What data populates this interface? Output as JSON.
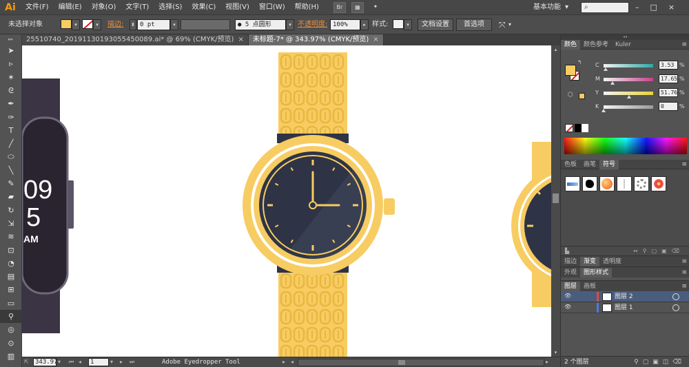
{
  "app": {
    "logo": "Ai"
  },
  "menu": [
    "文件(F)",
    "编辑(E)",
    "对象(O)",
    "文字(T)",
    "选择(S)",
    "效果(C)",
    "视图(V)",
    "窗口(W)",
    "帮助(H)"
  ],
  "workspace": {
    "label": "基本功能",
    "arrow": "▾"
  },
  "window_controls": [
    "–",
    "□",
    "×"
  ],
  "control_bar": {
    "selection_status": "未选择对象",
    "fill_color": "#f7cc62",
    "stroke_label": "描边:",
    "stroke_value": "0 pt",
    "brush_label": "5 点圆形",
    "opacity_label": "不透明度:",
    "opacity_value": "100%",
    "style_label": "样式:",
    "doc_setup_button": "文档设置",
    "preferences_button": "首选项"
  },
  "tabs": [
    {
      "label": "25510740_20191130193055450089.ai* @ 69% (CMYK/预览)",
      "close": "×",
      "active": false
    },
    {
      "label": "未标题-7* @ 343.97% (CMYK/预览)",
      "close": "×",
      "active": true
    }
  ],
  "status_bar": {
    "zoom": "343.97",
    "artboard": "1",
    "tool_name": "Adobe Eyedropper Tool"
  },
  "panels": {
    "color": {
      "tabs": [
        "颜色",
        "颜色参考",
        "Kuler"
      ],
      "fill_color": "#f7cc62",
      "channels": [
        {
          "label": "C",
          "value": "3.53",
          "unit": "%",
          "fraction": 0.035,
          "color": "#2fa8a8"
        },
        {
          "label": "M",
          "value": "17.65",
          "unit": "%",
          "fraction": 0.18,
          "color": "#c83f8a"
        },
        {
          "label": "Y",
          "value": "51.76",
          "unit": "%",
          "fraction": 0.52,
          "color": "#e8d43a"
        },
        {
          "label": "K",
          "value": "0",
          "unit": "%",
          "fraction": 0.0,
          "color": "#9a9a9a"
        }
      ]
    },
    "swatches": {
      "tabs": [
        "色板",
        "画笔",
        "符号"
      ]
    },
    "symbols": {
      "items": [
        "blue-bar-symbol",
        "ink-splat-symbol",
        "orange-ball-symbol",
        "light-symbol",
        "ring-symbol",
        "flower-symbol"
      ]
    },
    "stroke_group": {
      "tabs": [
        "描边",
        "渐变",
        "透明度"
      ]
    },
    "appearance_group": {
      "tabs": [
        "外观",
        "图形样式"
      ]
    },
    "layers": {
      "tabs": [
        "图层",
        "画板"
      ],
      "items": [
        {
          "name": "图层 2",
          "color": "#e04848",
          "selected": true
        },
        {
          "name": "图层 1",
          "color": "#4a7be0",
          "selected": false
        }
      ],
      "count_label": "2 个图层"
    }
  },
  "artwork": {
    "dial_center": "12:15",
    "digital_watch_time": [
      "09",
      "5",
      "AM"
    ],
    "colors": {
      "gold": "#f7cc62",
      "gold_dark": "#e8b740",
      "dial": "#2e3446",
      "dial_light": "#3b4256",
      "hand": "#f7cc62",
      "digital_body": "#3a3444",
      "digital_screen": "#2a2430"
    }
  }
}
